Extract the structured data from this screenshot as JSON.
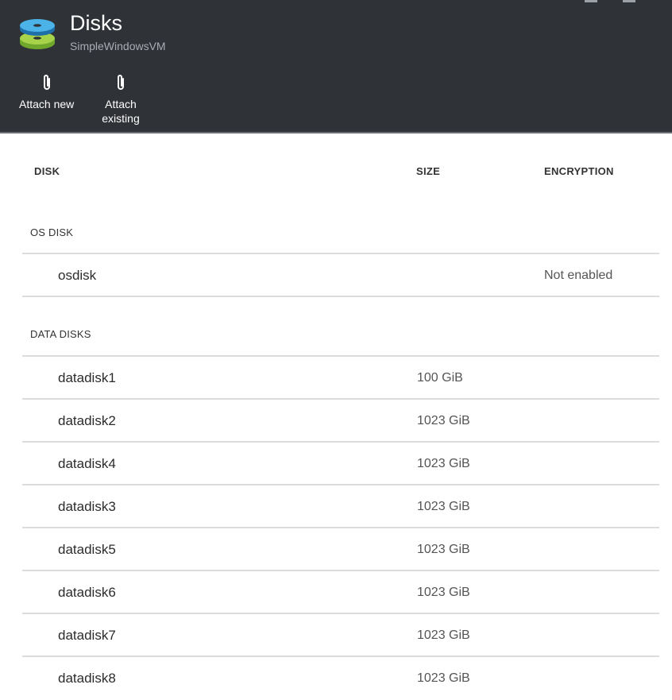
{
  "header": {
    "title": "Disks",
    "subtitle": "SimpleWindowsVM",
    "icon": "stacked-disks-icon",
    "commands": [
      {
        "label": "Attach new",
        "icon": "paperclip-icon"
      },
      {
        "label": "Attach\nexisting",
        "icon": "paperclip-icon"
      }
    ]
  },
  "columns": {
    "disk": "DISK",
    "size": "SIZE",
    "encryption": "ENCRYPTION"
  },
  "os_section": {
    "label": "OS DISK",
    "rows": [
      {
        "name": "osdisk",
        "size": "",
        "encryption": "Not enabled"
      }
    ]
  },
  "data_section": {
    "label": "DATA DISKS",
    "rows": [
      {
        "name": "datadisk1",
        "size": "100 GiB",
        "encryption": ""
      },
      {
        "name": "datadisk2",
        "size": "1023 GiB",
        "encryption": ""
      },
      {
        "name": "datadisk4",
        "size": "1023 GiB",
        "encryption": ""
      },
      {
        "name": "datadisk3",
        "size": "1023 GiB",
        "encryption": ""
      },
      {
        "name": "datadisk5",
        "size": "1023 GiB",
        "encryption": ""
      },
      {
        "name": "datadisk6",
        "size": "1023 GiB",
        "encryption": ""
      },
      {
        "name": "datadisk7",
        "size": "1023 GiB",
        "encryption": ""
      },
      {
        "name": "datadisk8",
        "size": "1023 GiB",
        "encryption": ""
      }
    ]
  },
  "colors": {
    "header_bg": "#2f3237",
    "disk_blue": "#3aa0d8",
    "disk_green": "#8cc63f",
    "divider": "#dcdcdc"
  }
}
